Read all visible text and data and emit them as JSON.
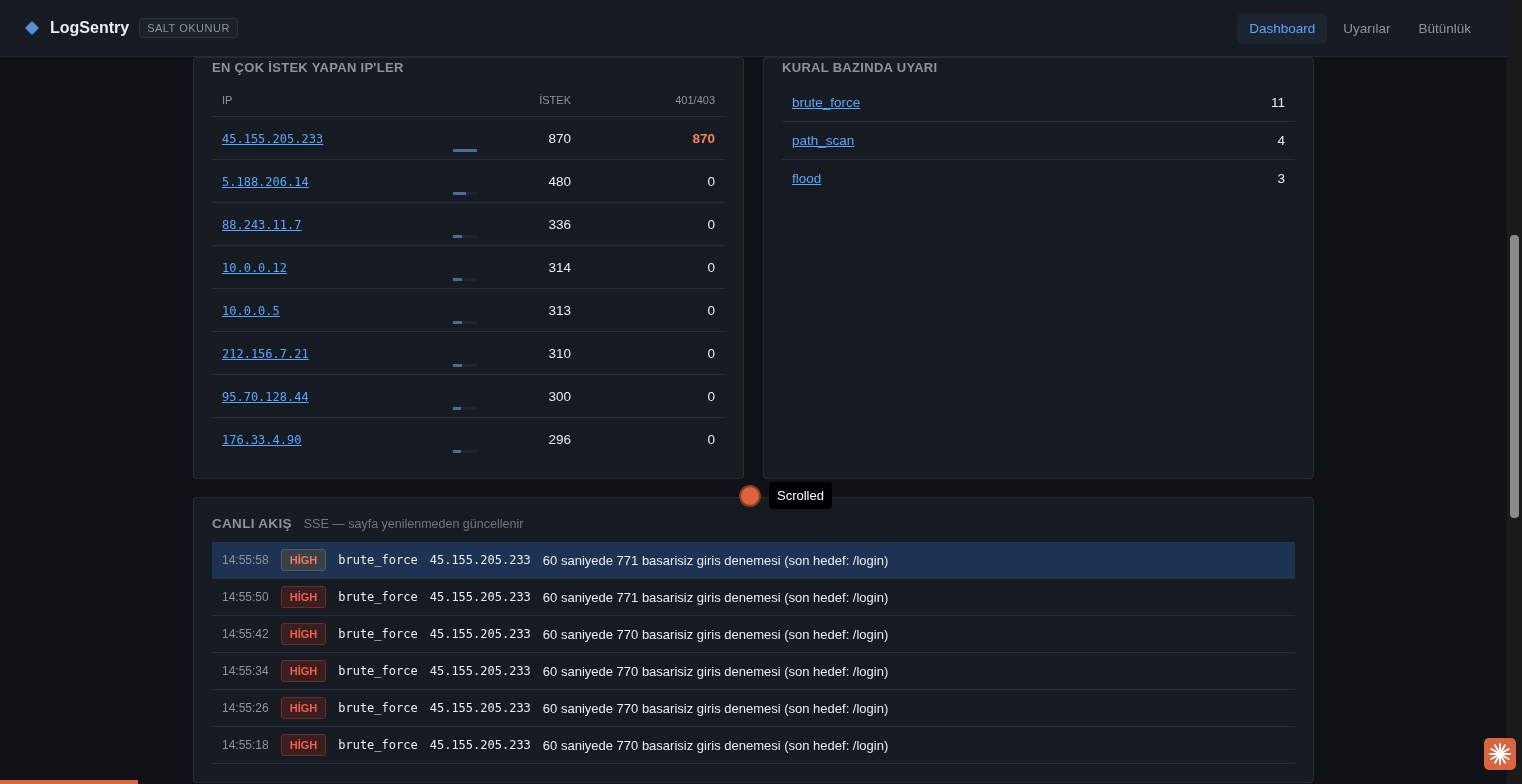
{
  "header": {
    "brand": "LogSentry",
    "badge": "SALT OKUNUR",
    "nav": [
      {
        "label": "Dashboard",
        "selected": true
      },
      {
        "label": "Uyarılar",
        "selected": false
      },
      {
        "label": "Bütünlük",
        "selected": false
      }
    ]
  },
  "top_ips": {
    "title": "EN ÇOK İSTEK YAPAN IP'LER",
    "columns": [
      "IP",
      "İSTEK",
      "401/403"
    ],
    "rows": [
      {
        "ip": "45.155.205.233",
        "requests": "870",
        "level": 1,
        "auth_fail": "870",
        "alert": true
      },
      {
        "ip": "5.188.206.14",
        "requests": "480",
        "level": 0.55,
        "auth_fail": "0",
        "alert": false
      },
      {
        "ip": "88.243.11.7",
        "requests": "336",
        "level": 0.38,
        "auth_fail": "0",
        "alert": false
      },
      {
        "ip": "10.0.0.12",
        "requests": "314",
        "level": 0.36,
        "auth_fail": "0",
        "alert": false
      },
      {
        "ip": "10.0.0.5",
        "requests": "313",
        "level": 0.36,
        "auth_fail": "0",
        "alert": false
      },
      {
        "ip": "212.156.7.21",
        "requests": "310",
        "level": 0.36,
        "auth_fail": "0",
        "alert": false
      },
      {
        "ip": "95.70.128.44",
        "requests": "300",
        "level": 0.34,
        "auth_fail": "0",
        "alert": false
      },
      {
        "ip": "176.33.4.90",
        "requests": "296",
        "level": 0.34,
        "auth_fail": "0",
        "alert": false
      }
    ]
  },
  "rule_alerts": {
    "title": "KURAL BAZINDA UYARI",
    "rows": [
      {
        "rule": "brute_force",
        "count": "11"
      },
      {
        "rule": "path_scan",
        "count": "4"
      },
      {
        "rule": "flood",
        "count": "3"
      }
    ]
  },
  "tooltip": {
    "label": "Scrolled"
  },
  "live_feed": {
    "title": "CANLI AKIŞ",
    "subtitle": "SSE — sayfa yenilenmeden güncellenir",
    "rows": [
      {
        "time": "14:55:58",
        "severity": "HİGH",
        "kind": "high",
        "rule": "brute_force",
        "ip": "45.155.205.233",
        "message": "60 saniyede 771 basarisiz giris denemesi (son hedef: /login)",
        "selected": true
      },
      {
        "time": "14:55:50",
        "severity": "HİGH",
        "kind": "high",
        "rule": "brute_force",
        "ip": "45.155.205.233",
        "message": "60 saniyede 771 basarisiz giris denemesi (son hedef: /login)",
        "selected": false
      },
      {
        "time": "14:55:42",
        "severity": "HİGH",
        "kind": "high",
        "rule": "brute_force",
        "ip": "45.155.205.233",
        "message": "60 saniyede 770 basarisiz giris denemesi (son hedef: /login)",
        "selected": false
      },
      {
        "time": "14:55:34",
        "severity": "HİGH",
        "kind": "high",
        "rule": "brute_force",
        "ip": "45.155.205.233",
        "message": "60 saniyede 770 basarisiz giris denemesi (son hedef: /login)",
        "selected": false
      },
      {
        "time": "14:55:26",
        "severity": "HİGH",
        "kind": "high",
        "rule": "brute_force",
        "ip": "45.155.205.233",
        "message": "60 saniyede 770 basarisiz giris denemesi (son hedef: /login)",
        "selected": false
      },
      {
        "time": "14:55:18",
        "severity": "HİGH",
        "kind": "high",
        "rule": "brute_force",
        "ip": "45.155.205.233",
        "message": "60 saniyede 770 basarisiz giris denemesi (son hedef: /login)",
        "selected": false
      }
    ]
  }
}
